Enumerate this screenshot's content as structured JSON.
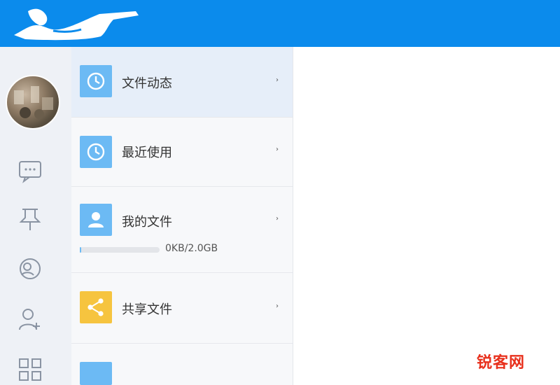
{
  "menu": {
    "items": [
      {
        "label": "文件动态",
        "icon": "clock-icon"
      },
      {
        "label": "最近使用",
        "icon": "clock-icon"
      },
      {
        "label": "我的文件",
        "icon": "user-icon"
      },
      {
        "label": "共享文件",
        "icon": "share-icon"
      }
    ],
    "chevron": "›",
    "storage": {
      "text": "0KB/2.0GB",
      "used_fraction": 0.0
    }
  },
  "rail": {
    "icons": [
      "chat-icon",
      "pin-icon",
      "contacts-icon",
      "add-contact-icon",
      "apps-grid-icon"
    ]
  },
  "watermark": "锐客网",
  "colors": {
    "topbar": "#0b8bec",
    "tile_blue": "#6cbaf4",
    "tile_yellow": "#f6c43f",
    "watermark": "#e8301c"
  }
}
